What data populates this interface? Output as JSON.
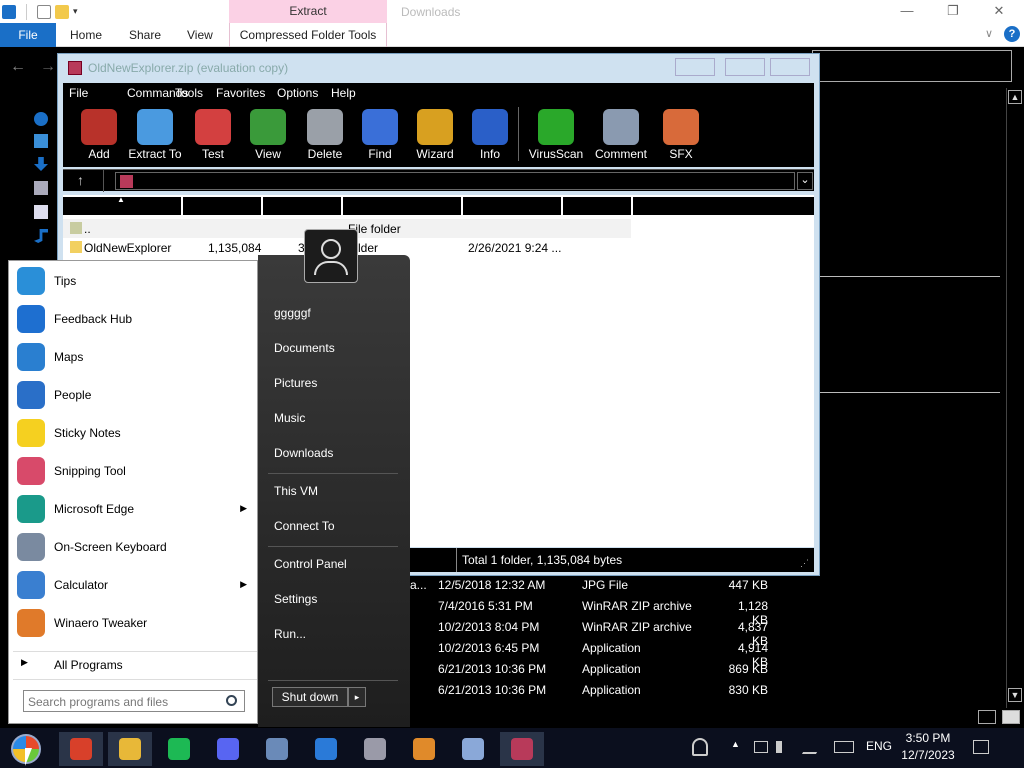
{
  "explorer": {
    "context_tab_header": "Extract",
    "window_title": "Downloads",
    "minimize": "—",
    "maximize": "❐",
    "close": "✕",
    "tabs": {
      "file": "File",
      "home": "Home",
      "share": "Share",
      "view": "View",
      "compressed": "Compressed Folder Tools"
    },
    "collapse_chevron": "∨",
    "help": "?",
    "back": "←",
    "forward": "→"
  },
  "winrar": {
    "title": "OldNewExplorer.zip (evaluation copy)",
    "menu": [
      "File",
      "Commands",
      "Tools",
      "Favorites",
      "Options",
      "Help"
    ],
    "toolbar": [
      {
        "label": "Add",
        "icon": "add-icon",
        "color": "#b8322a"
      },
      {
        "label": "Extract To",
        "icon": "folder-icon",
        "color": "#4a9ae0"
      },
      {
        "label": "Test",
        "icon": "clipboard-check-icon",
        "color": "#d34040"
      },
      {
        "label": "View",
        "icon": "book-icon",
        "color": "#3a9a3a"
      },
      {
        "label": "Delete",
        "icon": "trash-icon",
        "color": "#9aa0a8"
      },
      {
        "label": "Find",
        "icon": "magnifier-icon",
        "color": "#3a6fd8"
      },
      {
        "label": "Wizard",
        "icon": "wand-icon",
        "color": "#d8a020"
      },
      {
        "label": "Info",
        "icon": "info-icon",
        "color": "#2a5fc8"
      },
      {
        "label": "VirusScan",
        "icon": "bug-icon",
        "color": "#2aa82a"
      },
      {
        "label": "Comment",
        "icon": "comment-icon",
        "color": "#8a9ab0"
      },
      {
        "label": "SFX",
        "icon": "sfx-box-icon",
        "color": "#d86a3a"
      }
    ],
    "up_arrow": "↑",
    "dropdown_arrow": "⌄",
    "files": [
      {
        "name": "..",
        "size": "",
        "packed": "",
        "type": "File folder",
        "modified": ""
      },
      {
        "name": "OldNewExplorer",
        "size": "1,135,084",
        "packed": "34",
        "type": "folder",
        "modified": "2/26/2021 9:24 ..."
      }
    ],
    "status": "Total 1 folder, 1,135,084 bytes"
  },
  "background_rows": [
    {
      "name": "a...",
      "date": "12/5/2018 12:32 AM",
      "type": "JPG File",
      "size": "447 KB"
    },
    {
      "name": "",
      "date": "7/4/2016 5:31 PM",
      "type": "WinRAR ZIP archive",
      "size": "1,128 KB"
    },
    {
      "name": "",
      "date": "10/2/2013 8:04 PM",
      "type": "WinRAR ZIP archive",
      "size": "4,837 KB"
    },
    {
      "name": "",
      "date": "10/2/2013 6:45 PM",
      "type": "Application",
      "size": "4,914 KB"
    },
    {
      "name": "",
      "date": "6/21/2013 10:36 PM",
      "type": "Application",
      "size": "869 KB"
    },
    {
      "name": "",
      "date": "6/21/2013 10:36 PM",
      "type": "Application",
      "size": "830 KB"
    }
  ],
  "start_menu": {
    "programs": [
      {
        "label": "Tips",
        "icon": "lightbulb-icon",
        "color": "#2a8fd8",
        "submenu": false
      },
      {
        "label": "Feedback Hub",
        "icon": "feedback-icon",
        "color": "#1e6fd0",
        "submenu": false
      },
      {
        "label": "Maps",
        "icon": "map-pin-icon",
        "color": "#2a7fd0",
        "submenu": false
      },
      {
        "label": "People",
        "icon": "people-icon",
        "color": "#2a6fc8",
        "submenu": false
      },
      {
        "label": "Sticky Notes",
        "icon": "sticky-note-icon",
        "color": "#f5d020",
        "submenu": false
      },
      {
        "label": "Snipping Tool",
        "icon": "scissors-icon",
        "color": "#d84a6a",
        "submenu": false
      },
      {
        "label": "Microsoft Edge",
        "icon": "edge-icon",
        "color": "#1a9a8a",
        "submenu": true
      },
      {
        "label": "On-Screen Keyboard",
        "icon": "keyboard-icon",
        "color": "#7a8aa0",
        "submenu": false
      },
      {
        "label": "Calculator",
        "icon": "calculator-icon",
        "color": "#3a7fd0",
        "submenu": true
      },
      {
        "label": "Winaero Tweaker",
        "icon": "tweaker-icon",
        "color": "#e07a2a",
        "submenu": false
      }
    ],
    "all_programs": "All Programs",
    "search_placeholder": "Search programs and files",
    "user_name": "gggggf",
    "links": [
      "Documents",
      "Pictures",
      "Music",
      "Downloads",
      "This VM",
      "Connect To",
      "Control Panel",
      "Settings",
      "Run..."
    ],
    "shutdown": "Shut down",
    "shutdown_arrow": "▸"
  },
  "taskbar": {
    "apps": [
      {
        "name": "chrome-icon",
        "color": "#d8402a"
      },
      {
        "name": "file-explorer-icon",
        "color": "#e8b838"
      },
      {
        "name": "spotify-icon",
        "color": "#1db954"
      },
      {
        "name": "discord-icon",
        "color": "#5865f2"
      },
      {
        "name": "paint-icon",
        "color": "#6a8ab8"
      },
      {
        "name": "remote-desktop-icon",
        "color": "#2a7ad8"
      },
      {
        "name": "disc-icon",
        "color": "#9a9aa8"
      },
      {
        "name": "media-player-icon",
        "color": "#e08a2a"
      },
      {
        "name": "calculator-icon",
        "color": "#8aa8d8"
      },
      {
        "name": "winrar-icon",
        "color": "#b83a5a"
      }
    ],
    "language": "ENG",
    "time": "3:50 PM",
    "date": "12/7/2023"
  }
}
